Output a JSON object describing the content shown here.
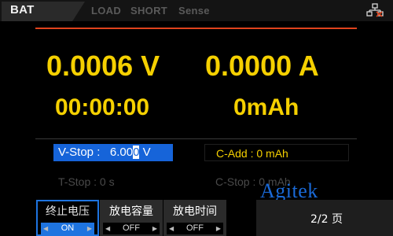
{
  "tabs": [
    {
      "label": "BAT",
      "active": true
    },
    {
      "label": "LOAD"
    },
    {
      "label": "SHORT"
    },
    {
      "label": "Sense"
    }
  ],
  "status": {
    "network_icon": "network-icon"
  },
  "readouts": {
    "voltage": "0.0006 V",
    "current": "0.0000 A",
    "elapsed_time": "00:00:00",
    "capacity": "0mAh"
  },
  "params": {
    "v_stop_label": "V-Stop :",
    "v_stop_value_pre": "6.00",
    "v_stop_cursor": "0",
    "v_stop_unit": "V",
    "c_add": "C-Add : 0 mAh",
    "t_stop": "T-Stop :      0 s",
    "c_stop": "C-Stop :      0 mAh"
  },
  "watermark": "Agitek",
  "softkeys": [
    {
      "label": "终止电压",
      "state": "ON",
      "active": true
    },
    {
      "label": "放电容量",
      "state": "OFF"
    },
    {
      "label": "放电时间",
      "state": "OFF"
    }
  ],
  "page_indicator": "2/2 页",
  "colors": {
    "accent": "#e0431d",
    "readout": "#f5d000",
    "highlight": "#1664d9"
  }
}
